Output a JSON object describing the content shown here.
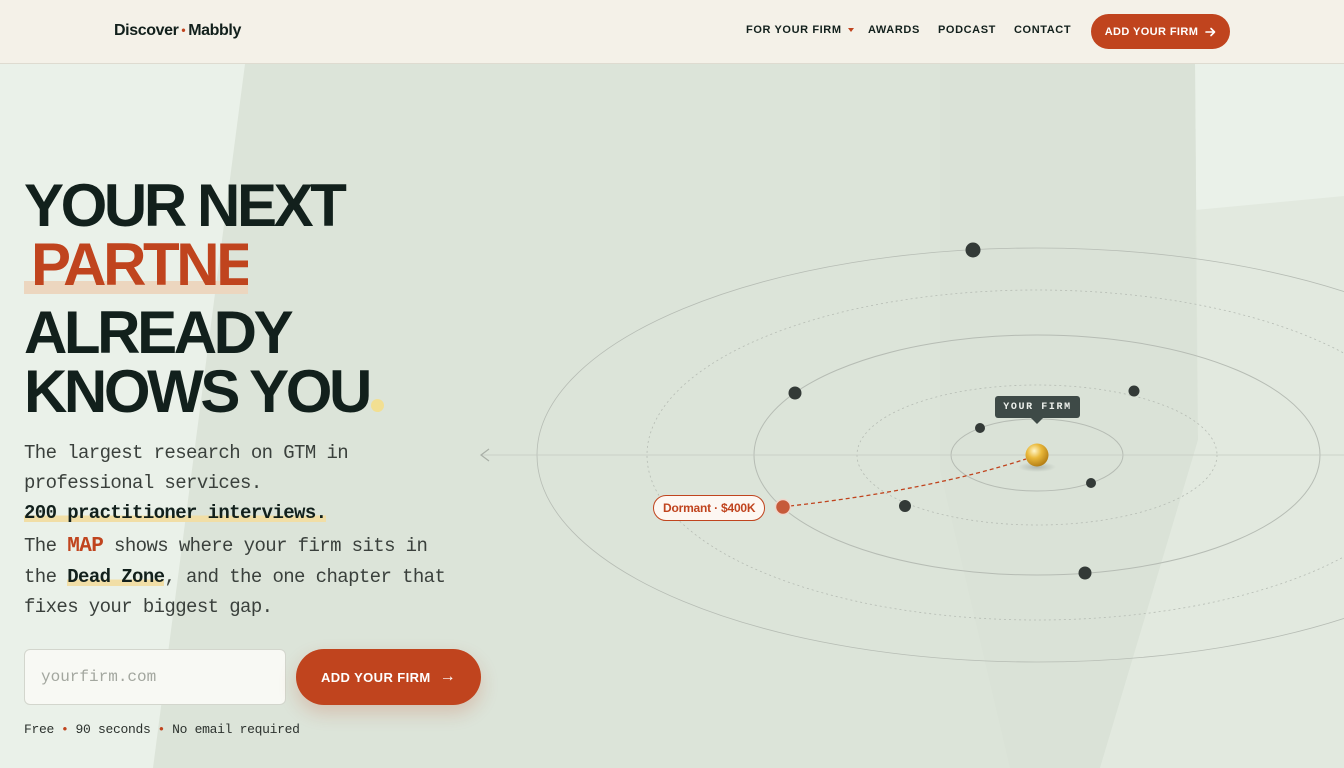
{
  "header": {
    "logo_left": "Discover",
    "logo_dot": "•",
    "logo_right": "Mabbly",
    "nav": [
      {
        "label": "FOR YOUR FIRM",
        "has_dropdown": true
      },
      {
        "label": "AWARDS"
      },
      {
        "label": "PODCAST"
      },
      {
        "label": "CONTACT"
      }
    ],
    "cta_label": "ADD YOUR FIRM",
    "cta_icon": "arrow-right-icon"
  },
  "hero": {
    "headline_line1": "YOUR NEXT",
    "headline_highlight": "PARTNER",
    "headline_line3": "ALREADY",
    "headline_line4": "KNOWS YOU",
    "lede_line1": "The largest research on GTM in",
    "lede_line2": "professional services.",
    "lede_emphasis": "200 practitioner interviews.",
    "lede_p2_a": "The ",
    "lede_p2_map": "MAP",
    "lede_p2_b": " shows where your firm sits in",
    "lede_p2_c": "the ",
    "lede_p2_deadzone": "Dead Zone",
    "lede_p2_d": ", and the one chapter that",
    "lede_p2_e": "fixes your biggest gap.",
    "input_placeholder": "yourfirm.com",
    "input_value": "",
    "cta_label": "ADD YOUR FIRM",
    "cta_arrow": "→",
    "fine_1": "Free",
    "fine_2": "90 seconds",
    "fine_3": "No email required",
    "fine_sep": "•"
  },
  "map": {
    "your_firm_label": "YOUR FIRM",
    "dormant_label": "Dormant · $400K",
    "colors": {
      "accent": "#c0441e",
      "node": "#333a37",
      "firm_sphere": "#e8b43a",
      "highlight": "#f1dea6"
    }
  }
}
